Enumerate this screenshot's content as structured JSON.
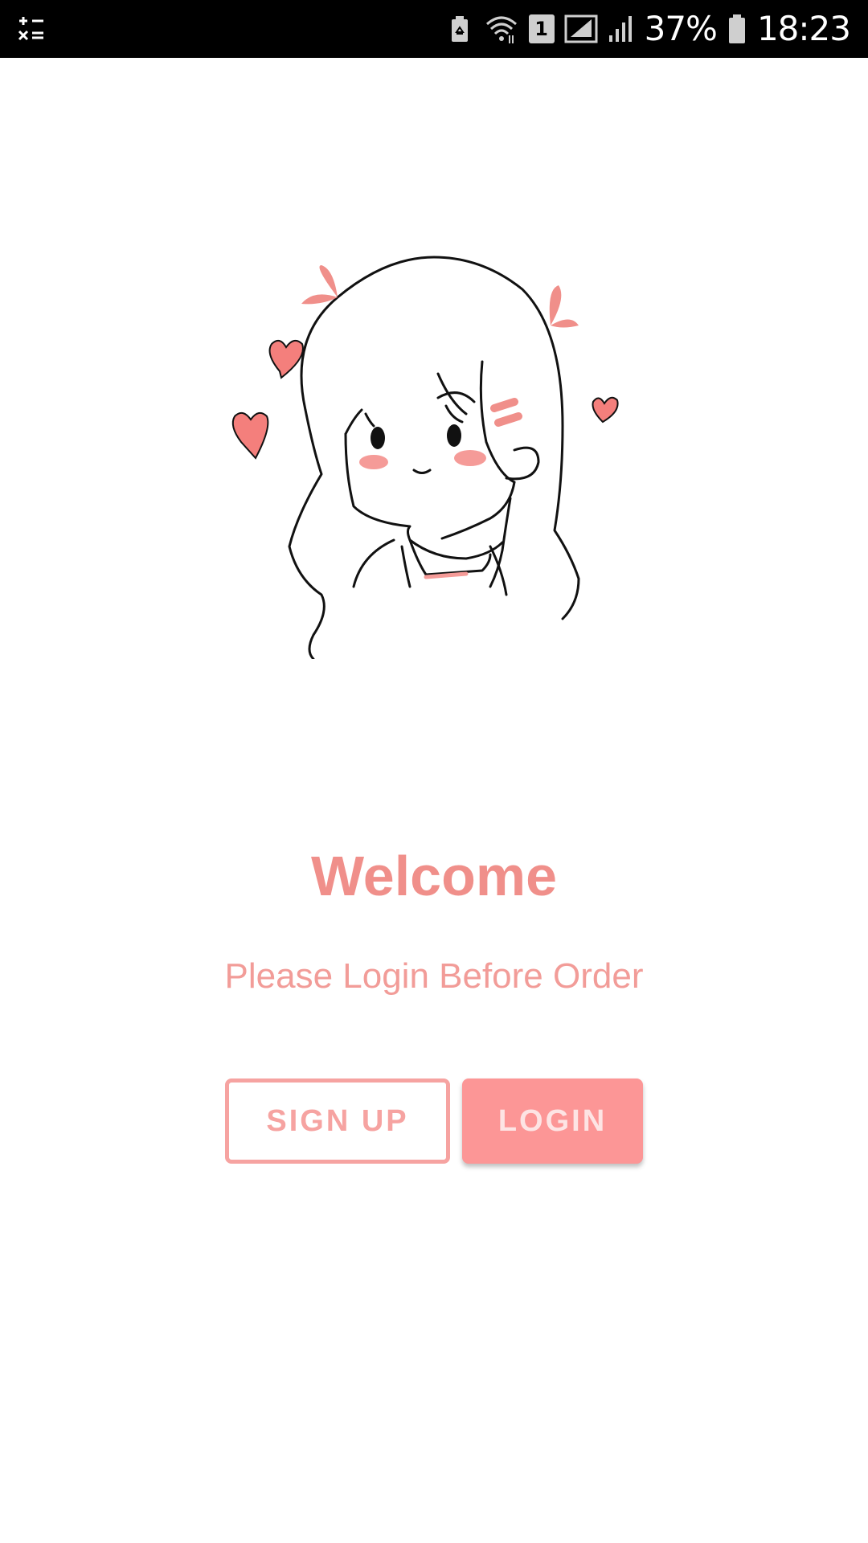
{
  "status_bar": {
    "battery_percent": "37%",
    "time": "18:23",
    "sim_badge": "1",
    "icons": [
      "calculator-icon",
      "battery-saver-icon",
      "wifi-icon",
      "sim-icon",
      "signal-icon",
      "signal-icon",
      "battery-icon"
    ]
  },
  "illustration": {
    "icon": "girl-with-hearts-illustration"
  },
  "welcome": {
    "title": "Welcome",
    "subtitle": "Please Login Before Order"
  },
  "actions": {
    "signup_label": "SIGN UP",
    "login_label": "LOGIN"
  },
  "colors": {
    "accent": "#f08f8a",
    "button_fill": "#fc9696",
    "outline": "#f6a3a1"
  }
}
